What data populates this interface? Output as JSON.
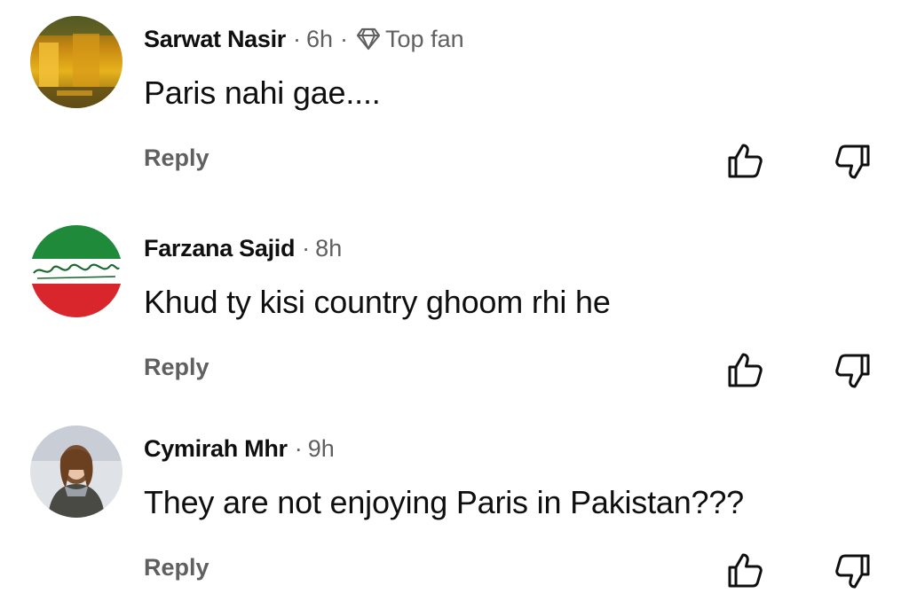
{
  "comments": [
    {
      "author": "Sarwat Nasir",
      "time": "6h",
      "badge": "Top fan",
      "text": "Paris nahi gae....",
      "reply_label": "Reply",
      "avatar": "autumn-landscape-photo"
    },
    {
      "author": "Farzana Sajid",
      "time": "8h",
      "text": "Khud ty kisi country ghoom rhi he",
      "reply_label": "Reply",
      "avatar": "green-white-red-calligraphy"
    },
    {
      "author": "Cymirah Mhr",
      "time": "9h",
      "text": "They are not enjoying Paris in Pakistan???",
      "reply_label": "Reply",
      "avatar": "person-in-snow-photo"
    }
  ],
  "separator": "·",
  "icons": {
    "like": "thumbs-up-icon",
    "dislike": "thumbs-down-icon",
    "badge": "diamond-icon"
  },
  "colors": {
    "text": "#0f0f0f",
    "secondary": "#606060",
    "background": "#ffffff"
  }
}
